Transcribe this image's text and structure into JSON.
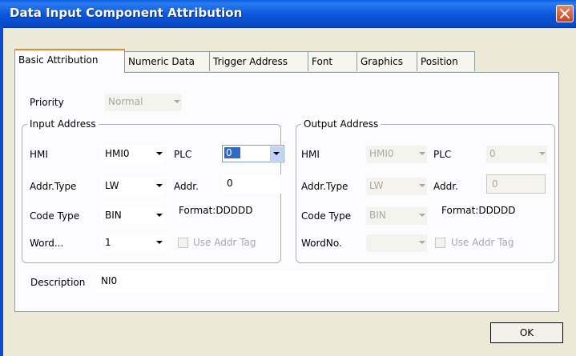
{
  "window": {
    "title": "Data Input Component Attribution"
  },
  "tabs": [
    {
      "label": "Basic Attribution"
    },
    {
      "label": "Numeric Data"
    },
    {
      "label": "Trigger Address"
    },
    {
      "label": "Font"
    },
    {
      "label": "Graphics"
    },
    {
      "label": "Position"
    }
  ],
  "priority": {
    "label": "Priority",
    "value": "Normal"
  },
  "input_address": {
    "legend": "Input Address",
    "hmi_label": "HMI",
    "hmi_value": "HMI0",
    "plc_label": "PLC",
    "plc_value": "0",
    "addr_type_label": "Addr.Type",
    "addr_type_value": "LW",
    "addr_label": "Addr.",
    "addr_value": "0",
    "code_type_label": "Code Type",
    "code_type_value": "BIN",
    "format_text": "Format:DDDDD",
    "word_label": "Word...",
    "word_value": "1",
    "use_addr_tag_label": "Use Addr Tag"
  },
  "output_address": {
    "legend": "Output Address",
    "hmi_label": "HMI",
    "hmi_value": "HMI0",
    "plc_label": "PLC",
    "plc_value": "0",
    "addr_type_label": "Addr.Type",
    "addr_type_value": "LW",
    "addr_label": "Addr.",
    "addr_value": "0",
    "code_type_label": "Code Type",
    "code_type_value": "BIN",
    "format_text": "Format:DDDDD",
    "word_label": "WordNo.",
    "word_value": "",
    "use_addr_tag_label": "Use Addr Tag"
  },
  "description": {
    "label": "Description",
    "value": "NI0"
  },
  "buttons": {
    "ok": "OK"
  },
  "colors": {
    "title_bar": "#0A5FE0",
    "dialog_bg": "#ECE9D8",
    "selection": "#316AC5",
    "active_tab_accent": "#E68B2C",
    "close_button": "#D9532B"
  }
}
